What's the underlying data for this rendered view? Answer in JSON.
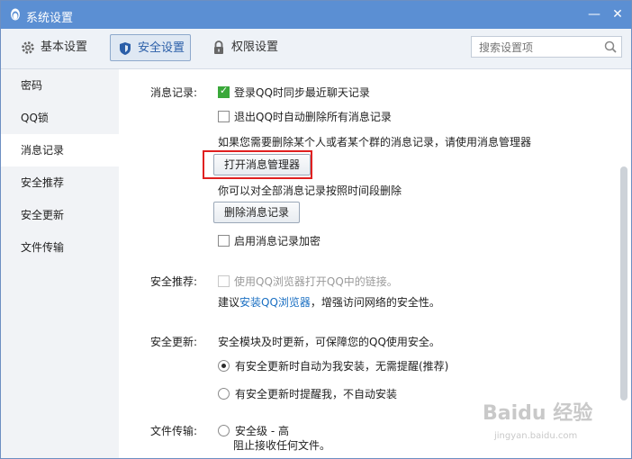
{
  "window": {
    "title": "系统设置",
    "minimize": "—",
    "close": "✕"
  },
  "tabs": [
    {
      "label": "基本设置",
      "icon": "gear-icon"
    },
    {
      "label": "安全设置",
      "icon": "shield-icon"
    },
    {
      "label": "权限设置",
      "icon": "lock-icon"
    }
  ],
  "search": {
    "placeholder": "搜索设置项"
  },
  "sidebar": {
    "items": [
      "密码",
      "QQ锁",
      "消息记录",
      "安全推荐",
      "安全更新",
      "文件传输"
    ]
  },
  "message_record": {
    "label": "消息记录:",
    "sync_login": "登录QQ时同步最近聊天记录",
    "delete_on_exit": "退出QQ时自动删除所有消息记录",
    "hint": "如果您需要删除某个人或者某个群的消息记录，请使用消息管理器",
    "open_manager_button": "打开消息管理器",
    "delete_hint": "你可以对全部消息记录按照时间段删除",
    "delete_button": "删除消息记录",
    "encrypt": "启用消息记录加密"
  },
  "security_recommend": {
    "label": "安全推荐:",
    "option": "使用QQ浏览器打开QQ中的链接。",
    "tip_prefix": "建议",
    "tip_link": "安装QQ浏览器",
    "tip_suffix": "，增强访问网络的安全性。"
  },
  "security_update": {
    "label": "安全更新:",
    "desc": "安全模块及时更新，可保障您的QQ使用安全。",
    "auto_install": "有安全更新时自动为我安装，无需提醒(推荐)",
    "remind": "有安全更新时提醒我，不自动安装"
  },
  "file_transfer": {
    "label": "文件传输:",
    "level_high": "安全级 - 高",
    "level_high_desc": "阻止接收任何文件。"
  },
  "watermark": {
    "text": "Baidu 经验",
    "url": "jingyan.baidu.com"
  },
  "colors": {
    "titlebar": "#5b8fd3",
    "highlight": "#e02020",
    "link": "#1a6fc2",
    "check": "#3aa83a"
  }
}
